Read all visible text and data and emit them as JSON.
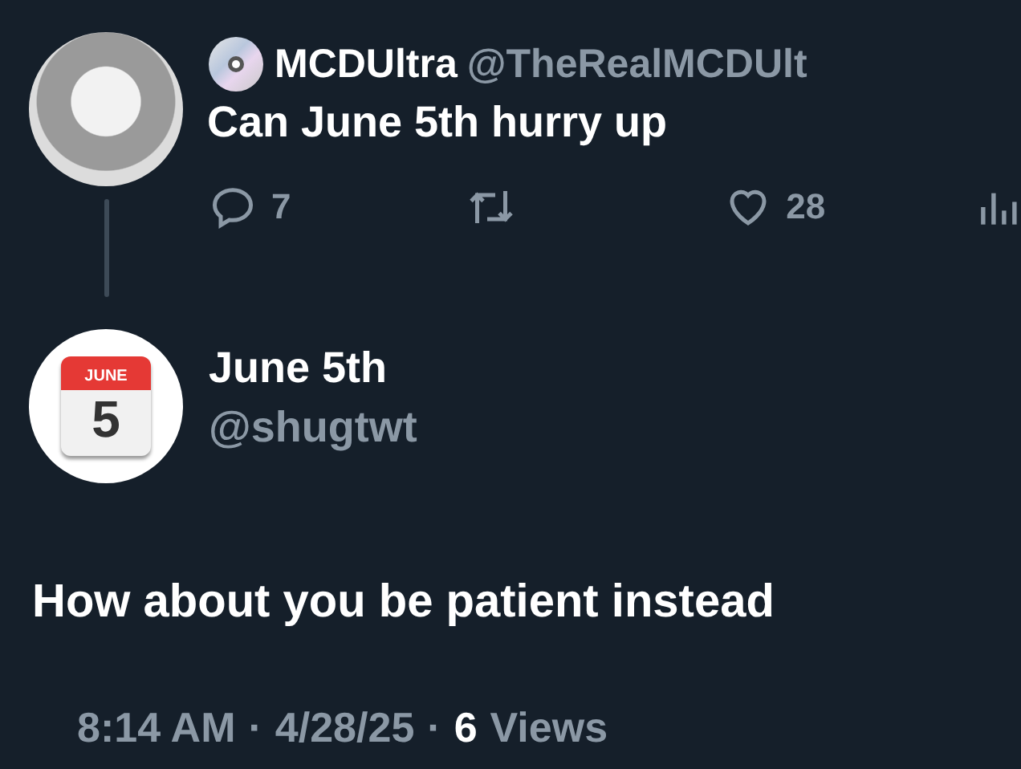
{
  "parent_tweet": {
    "display_name": "MCDUltra",
    "handle": "@TheRealMCDUlt",
    "text": "Can June 5th hurry up",
    "actions": [
      {
        "kind": "reply",
        "count": "7"
      },
      {
        "kind": "repost"
      },
      {
        "kind": "like",
        "count": "28"
      },
      {
        "kind": "views"
      }
    ]
  },
  "reply_tweet": {
    "display_name": "June 5th",
    "handle": "@shugtwt",
    "avatar": {
      "month": "JUNE",
      "day": "5"
    },
    "text": "How about you be patient instead",
    "time": "8:14 AM",
    "separator_1": "·",
    "date": "4/28/25",
    "separator_2": "·",
    "views_count": "6",
    "views_label": "Views"
  }
}
